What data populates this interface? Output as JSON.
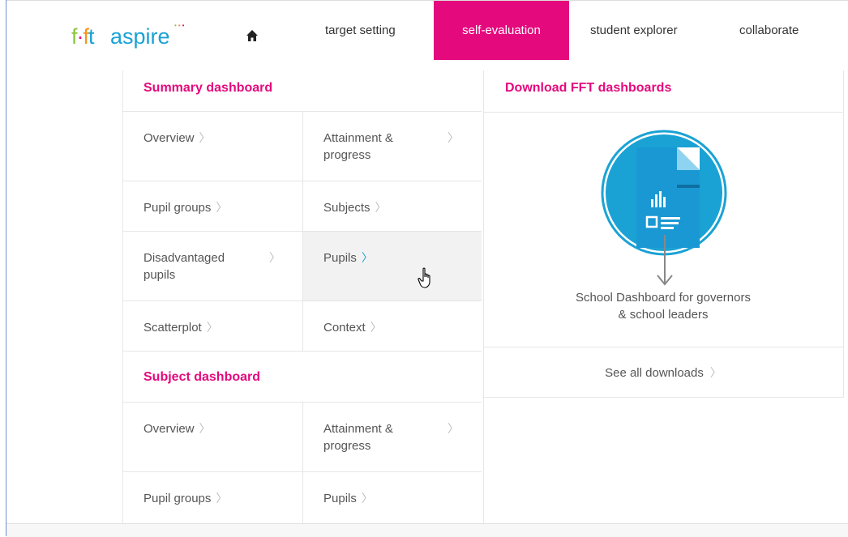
{
  "brand": {
    "logo_text": "fft aspire",
    "colors": {
      "magenta": "#e4097d",
      "blue": "#1aa2d4",
      "green": "#8dc63f",
      "orange": "#f7941d"
    }
  },
  "nav": {
    "home_icon": "home-icon",
    "items": [
      {
        "label": "target setting",
        "active": false
      },
      {
        "label": "self-evaluation",
        "active": true
      },
      {
        "label": "student explorer",
        "active": false
      },
      {
        "label": "collaborate",
        "active": false
      }
    ]
  },
  "summary_dashboard": {
    "heading": "Summary dashboard",
    "items": [
      {
        "label": "Overview"
      },
      {
        "label": "Attainment & progress"
      },
      {
        "label": "Pupil groups"
      },
      {
        "label": "Subjects"
      },
      {
        "label": "Disadvantaged pupils"
      },
      {
        "label": "Pupils",
        "hovered": true
      },
      {
        "label": "Scatterplot"
      },
      {
        "label": "Context"
      }
    ]
  },
  "subject_dashboard": {
    "heading": "Subject dashboard",
    "items": [
      {
        "label": "Overview"
      },
      {
        "label": "Attainment & progress"
      },
      {
        "label": "Pupil groups"
      },
      {
        "label": "Pupils"
      }
    ]
  },
  "downloads": {
    "heading": "Download FFT dashboards",
    "doc_icon": "document-download-icon",
    "caption_line1": "School Dashboard for governors",
    "caption_line2": "& school leaders",
    "see_all": "See all downloads"
  },
  "chevron": "〉"
}
